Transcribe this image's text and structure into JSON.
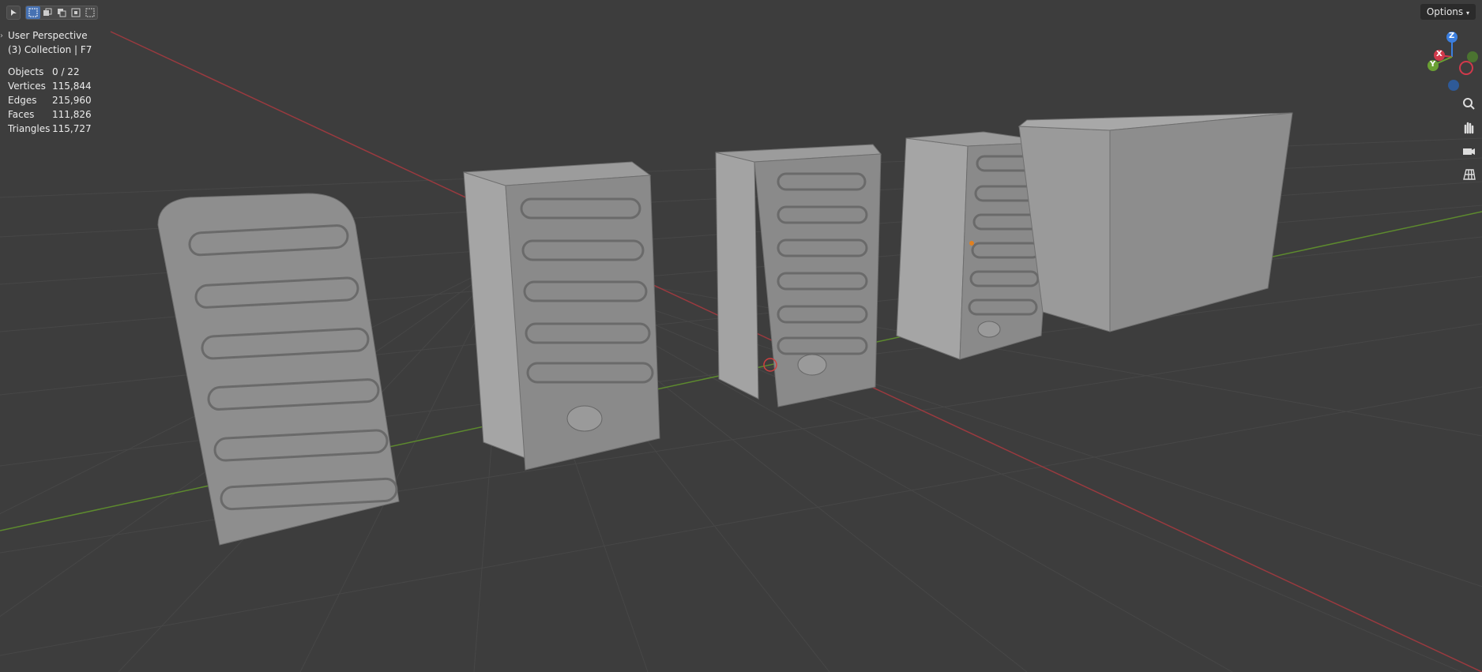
{
  "header": {
    "options_label": "Options"
  },
  "overlay": {
    "view_name": "User Perspective",
    "collection": "(3) Collection | F7"
  },
  "stats": [
    {
      "label": "Objects",
      "value": "0 / 22"
    },
    {
      "label": "Vertices",
      "value": "115,844"
    },
    {
      "label": "Edges",
      "value": "215,960"
    },
    {
      "label": "Faces",
      "value": "111,826"
    },
    {
      "label": "Triangles",
      "value": "115,727"
    }
  ],
  "gizmo": {
    "z_label": "Z",
    "y_label": "Y",
    "x_label": "X",
    "colors": {
      "x": "#d1394b",
      "y": "#6aa033",
      "z": "#3b7fe0"
    }
  },
  "nav_icons": [
    "zoom-icon",
    "pan-hand-icon",
    "camera-icon",
    "grid-view-icon"
  ],
  "colors": {
    "background": "#3d3d3d",
    "grid": "#4a4a4a",
    "x_axis": "#9a3a3f",
    "y_axis": "#5d8a2e",
    "model": "#8f8f8f"
  }
}
